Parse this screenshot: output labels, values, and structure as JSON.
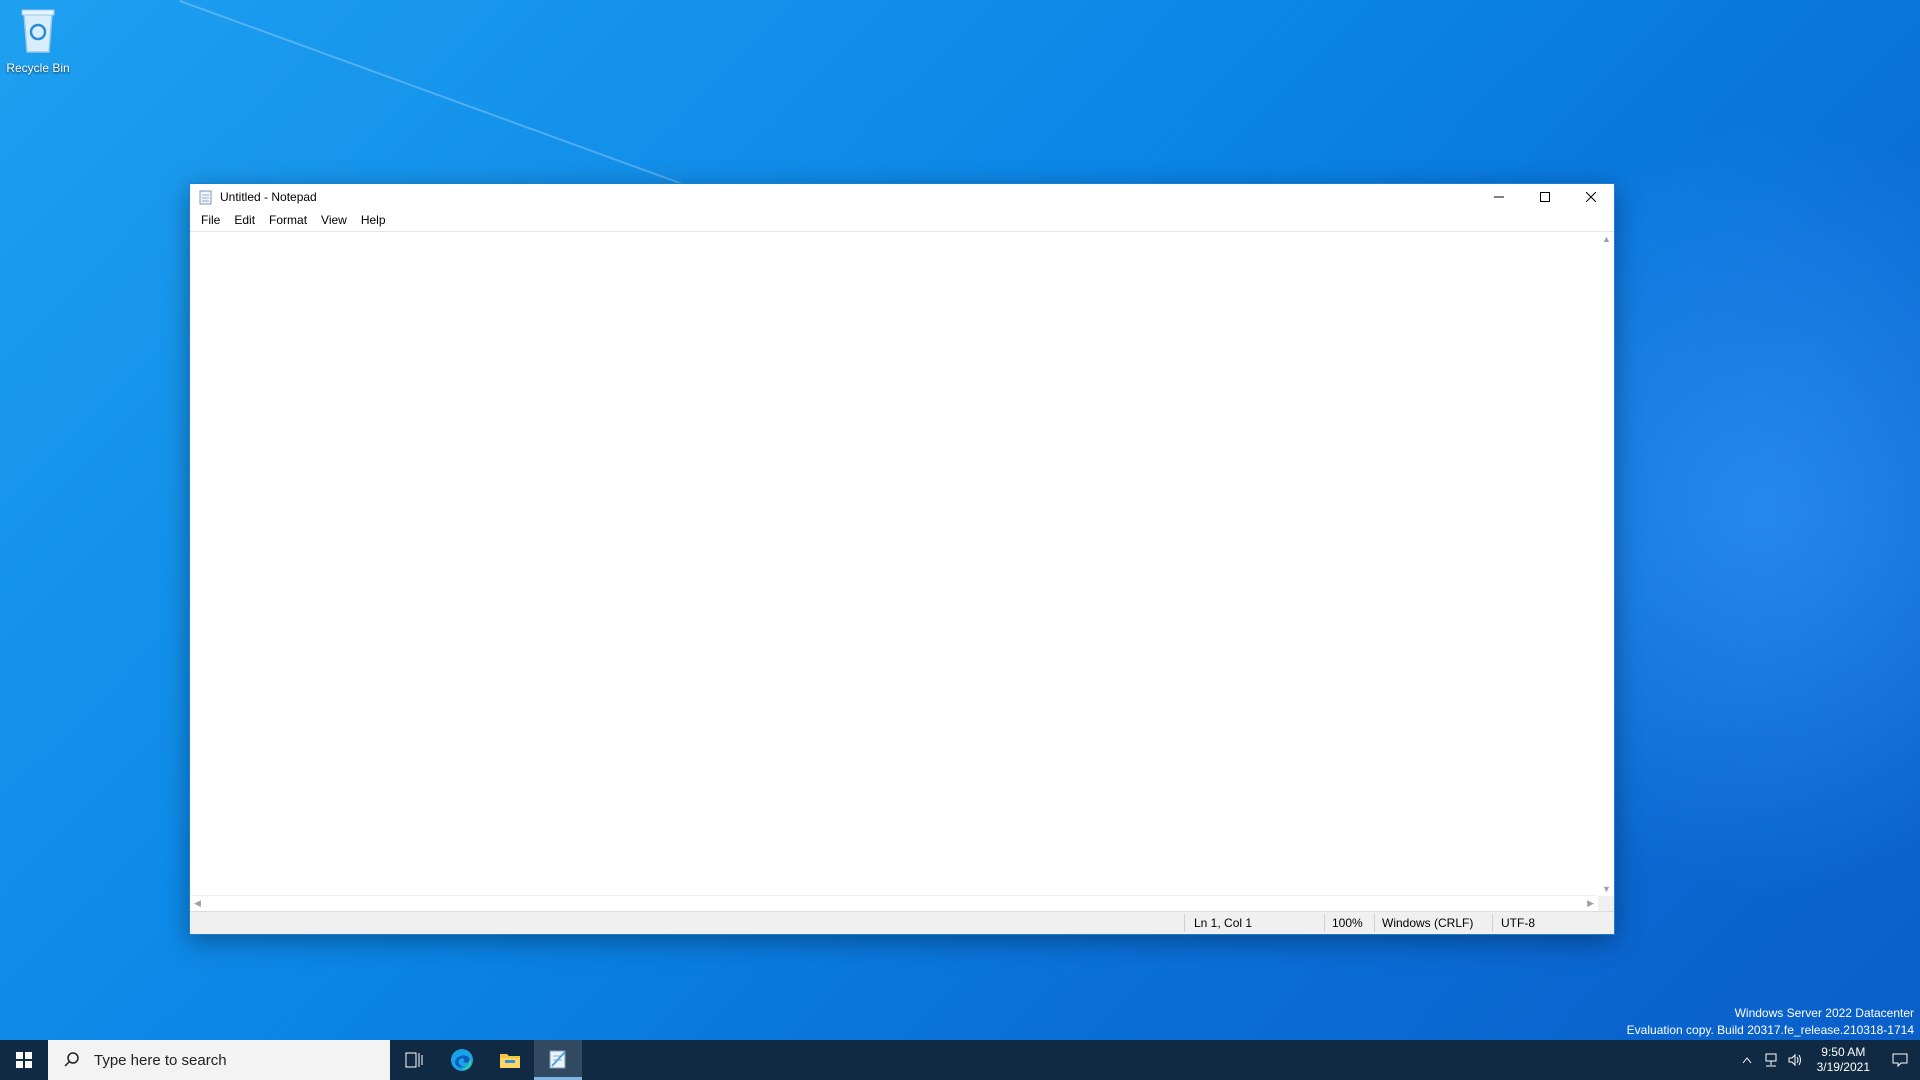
{
  "desktop": {
    "recycle_bin_label": "Recycle Bin",
    "watermark_line1": "Windows Server 2022 Datacenter",
    "watermark_line2": "Evaluation copy. Build 20317.fe_release.210318-1714"
  },
  "window": {
    "title": "Untitled - Notepad",
    "menu": [
      "File",
      "Edit",
      "Format",
      "View",
      "Help"
    ],
    "status": {
      "position": "Ln 1, Col 1",
      "zoom": "100%",
      "line_ending": "Windows (CRLF)",
      "encoding": "UTF-8"
    }
  },
  "taskbar": {
    "search_placeholder": "Type here to search",
    "clock_time": "9:50 AM",
    "clock_date": "3/19/2021"
  },
  "colors": {
    "taskbar": "#102a43",
    "accent": "#0a84e6"
  }
}
